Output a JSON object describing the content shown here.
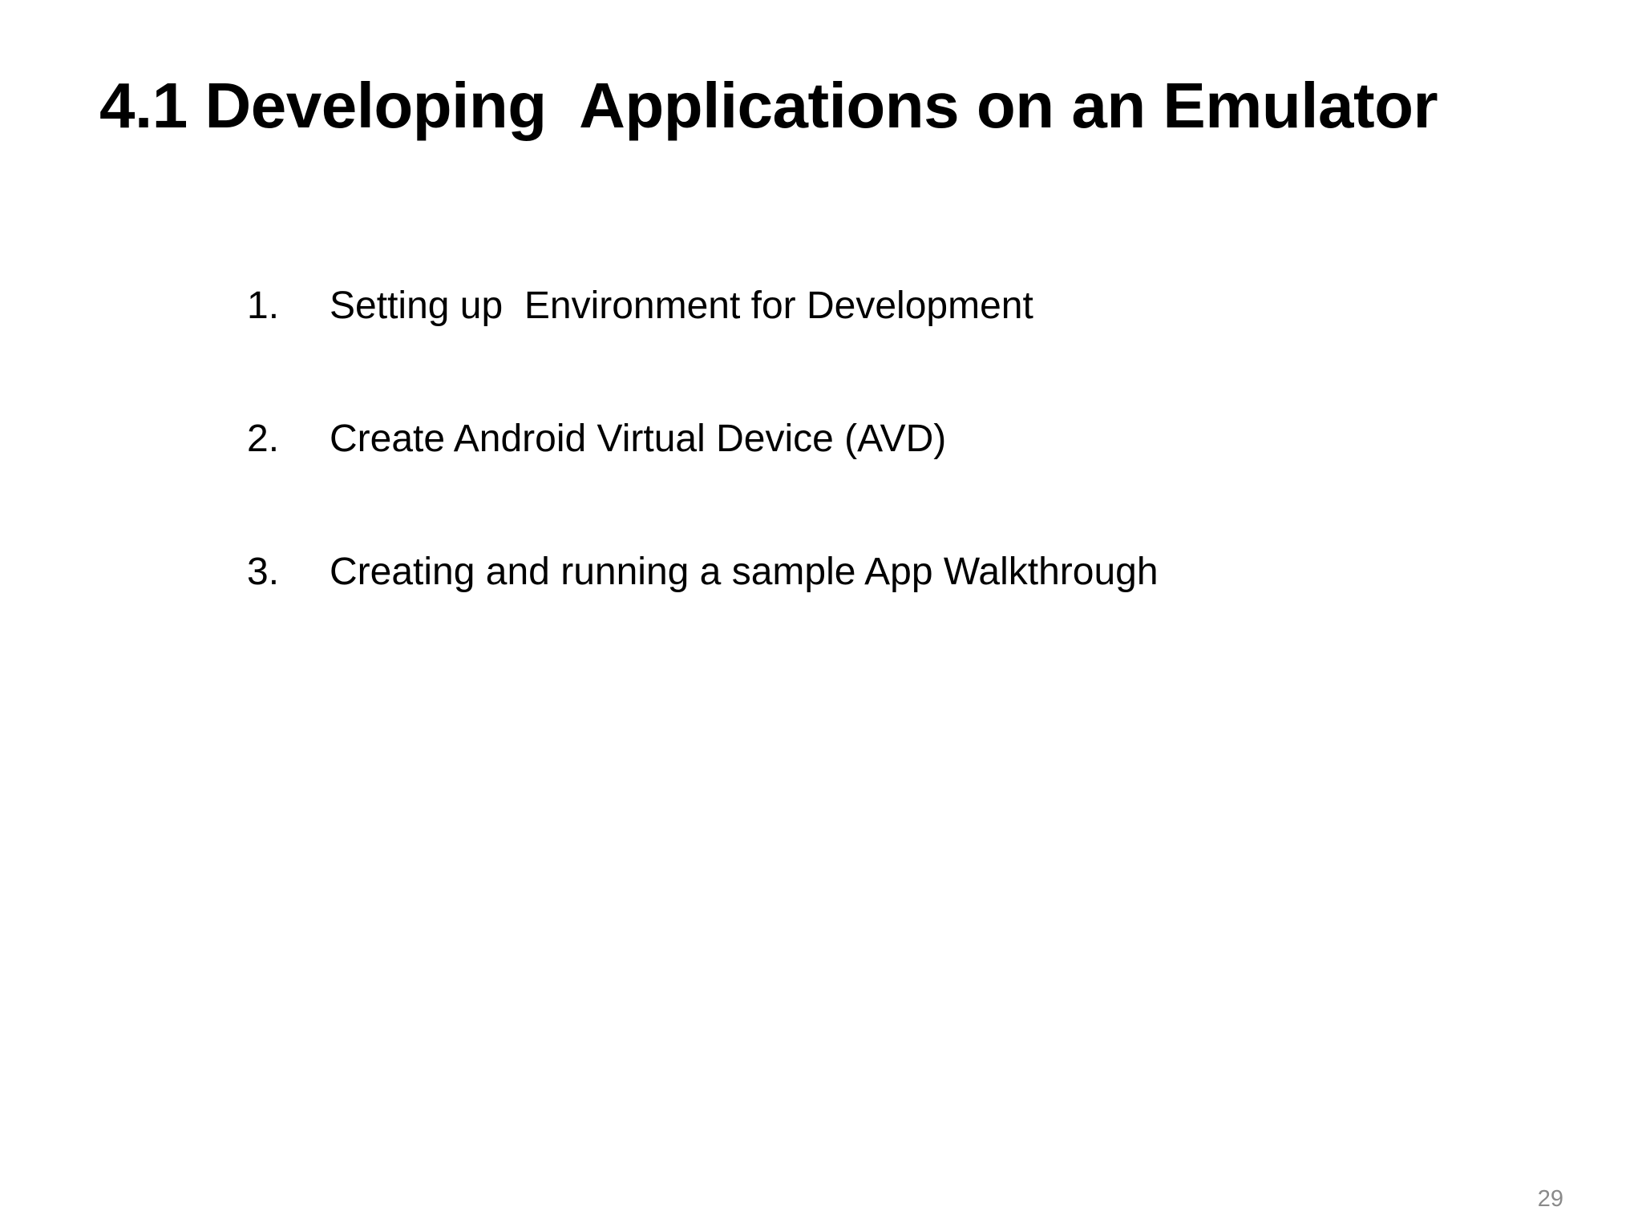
{
  "slide": {
    "title": "4.1 Developing  Applications on an Emulator",
    "items": [
      {
        "number": "1.",
        "text": "Setting up  Environment for Development"
      },
      {
        "number": "2.",
        "text": "Create Android Virtual Device (AVD)"
      },
      {
        "number": "3.",
        "text": "Creating and running a sample App Walkthrough"
      }
    ],
    "page_number": "29"
  }
}
